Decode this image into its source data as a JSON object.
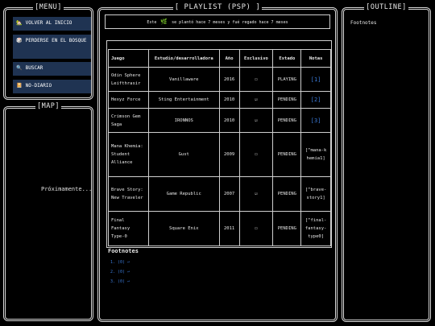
{
  "menu": {
    "title": "[MENU]",
    "items": [
      {
        "icon": "🏡",
        "label": "VOLVER AL INICIO"
      },
      {
        "icon": "🎲",
        "label": "PERDERSE EN EL BOSQUE"
      },
      {
        "icon": "🔍",
        "label": "BUSCAR"
      },
      {
        "icon": "📔",
        "label": "NO-DIARIO"
      }
    ]
  },
  "map": {
    "title": "[MAP]",
    "placeholder": "Próximamente..."
  },
  "main": {
    "title": "[ PLAYLIST (PSP) ]",
    "banner": {
      "pre": "Este",
      "emoji": "🌿",
      "post": "se plantó hace 7 meses y fué regado hace 7 meses"
    },
    "table": {
      "headers": [
        "Juego",
        "Estudio/desarrolladora",
        "Año",
        "Exclusivo",
        "Estado",
        "Notas"
      ],
      "rows": [
        {
          "game": "Odin Sphere Leifthrasir",
          "studio": "Vanillaware",
          "year": "2016",
          "exclusive": "☐",
          "status": "PLAYING",
          "notes": "[1]"
        },
        {
          "game": "Hexyz Force",
          "studio": "Sting Entertainment",
          "year": "2010",
          "exclusive": "☑",
          "status": "PENDING",
          "notes": "[2]"
        },
        {
          "game": "Crimson Gem Saga",
          "studio": "IRONNOS",
          "year": "2010",
          "exclusive": "☑",
          "status": "PENDING",
          "notes": "[3]"
        },
        {
          "game": "Mana Khemia: Student Alliance",
          "studio": "Gust",
          "year": "2009",
          "exclusive": "☐",
          "status": "PENDING",
          "notes": "[^mana-khemia1]"
        },
        {
          "game": "Brave Story: New Traveler",
          "studio": "Game Republic",
          "year": "2007",
          "exclusive": "☑",
          "status": "PENDING",
          "notes": "[^brave-story1]"
        },
        {
          "game": "Final Fantasy Type-0",
          "studio": "Square Enix",
          "year": "2011",
          "exclusive": "☐",
          "status": "PENDING",
          "notes": "[^final-fantasy-type0]"
        }
      ]
    },
    "footnotes": {
      "heading": "Footnotes",
      "items": [
        "1. (0) ↩",
        "2. (0) ↩",
        "3. (0) ↩"
      ]
    }
  },
  "outline": {
    "title": "[OUTLINE]",
    "items": [
      "Footnotes"
    ]
  },
  "colors": {
    "background": "#000000",
    "button": "#1f3352",
    "link": "#3b7ad8",
    "leaf": "#2ecc71"
  }
}
